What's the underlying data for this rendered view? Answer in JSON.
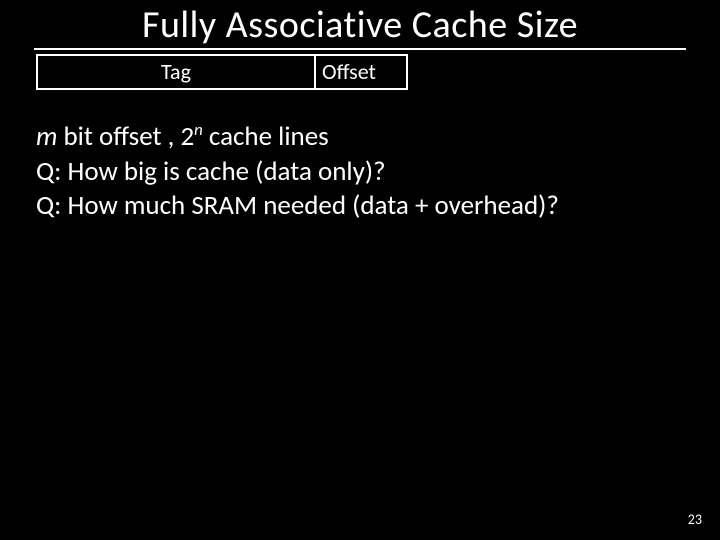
{
  "title": "Fully Associative Cache Size",
  "fields": {
    "tag_label": "Tag",
    "offset_label": "Offset"
  },
  "body": {
    "line1_prefix_italic": "m",
    "line1_mid": " bit offset , 2",
    "line1_sup": "n",
    "line1_suffix": " cache lines",
    "line2": "Q: How big is cache (data only)?",
    "line3": "Q: How much SRAM needed (data + overhead)?"
  },
  "page_number": "23"
}
